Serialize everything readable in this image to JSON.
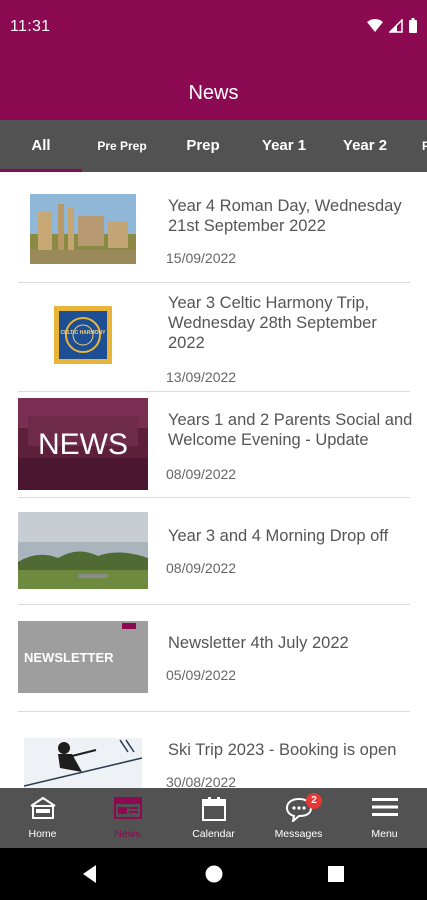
{
  "status_bar": {
    "time": "11:31"
  },
  "header": {
    "title": "News"
  },
  "tabs": [
    {
      "label": "All",
      "active": true
    },
    {
      "label": "Pre Prep",
      "active": false
    },
    {
      "label": "Prep",
      "active": false
    },
    {
      "label": "Year 1",
      "active": false
    },
    {
      "label": "Year 2",
      "active": false
    },
    {
      "label": "P",
      "active": false
    }
  ],
  "news": [
    {
      "title": "Year 4 Roman Day, Wednesday 21st September 2022",
      "date": "15/09/2022"
    },
    {
      "title": "Year 3 Celtic Harmony Trip, Wednesday 28th September 2022",
      "date": "13/09/2022",
      "thumb_text": "CELTIC HARMONY"
    },
    {
      "title": "Years 1 and 2 Parents Social and Welcome Evening - Update",
      "date": "08/09/2022",
      "thumb_text": "NEWS"
    },
    {
      "title": "Year 3 and 4 Morning Drop off",
      "date": "08/09/2022"
    },
    {
      "title": "Newsletter 4th July 2022",
      "date": "05/09/2022",
      "thumb_text": "NEWSLETTER"
    },
    {
      "title": "Ski Trip 2023 - Booking is open",
      "date": "30/08/2022"
    }
  ],
  "bottom_nav": [
    {
      "label": "Home",
      "icon": "home-icon"
    },
    {
      "label": "News",
      "icon": "news-icon",
      "active": true
    },
    {
      "label": "Calendar",
      "icon": "calendar-icon"
    },
    {
      "label": "Messages",
      "icon": "messages-icon",
      "badge": "2"
    },
    {
      "label": "Menu",
      "icon": "menu-icon"
    }
  ],
  "colors": {
    "brand": "#8b0a52",
    "bar": "#525252",
    "badge": "#e53935"
  }
}
